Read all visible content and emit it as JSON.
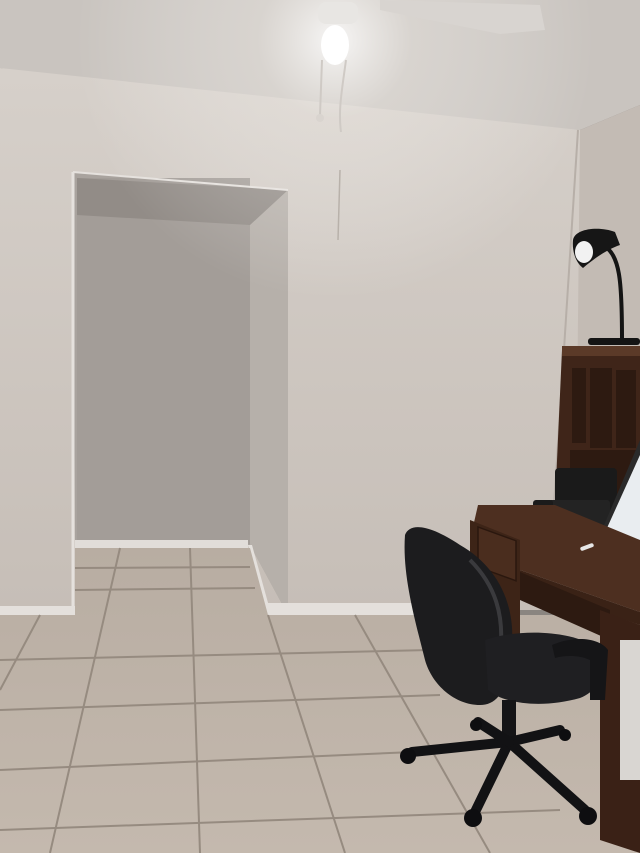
{
  "scene": {
    "colors": {
      "ceiling": "#c9c4bf",
      "wall": "#cdc6c0",
      "wall_shadow": "#b3aca6",
      "alcove": "#a8a29d",
      "baseboard": "#e4e0dc",
      "floor_tile": "#bdb2a7",
      "grout": "#8f857b",
      "desk_wood": "#4a2e1f",
      "chair": "#1c1c1e",
      "lamp": "#1a1a1a",
      "bulb": "#ffffff"
    },
    "objects": [
      "ceiling-fan-light",
      "wall-alcove",
      "desk-lamp",
      "wooden-hutch",
      "printer",
      "computer-monitor",
      "wooden-desk",
      "office-chair",
      "tile-floor"
    ]
  }
}
